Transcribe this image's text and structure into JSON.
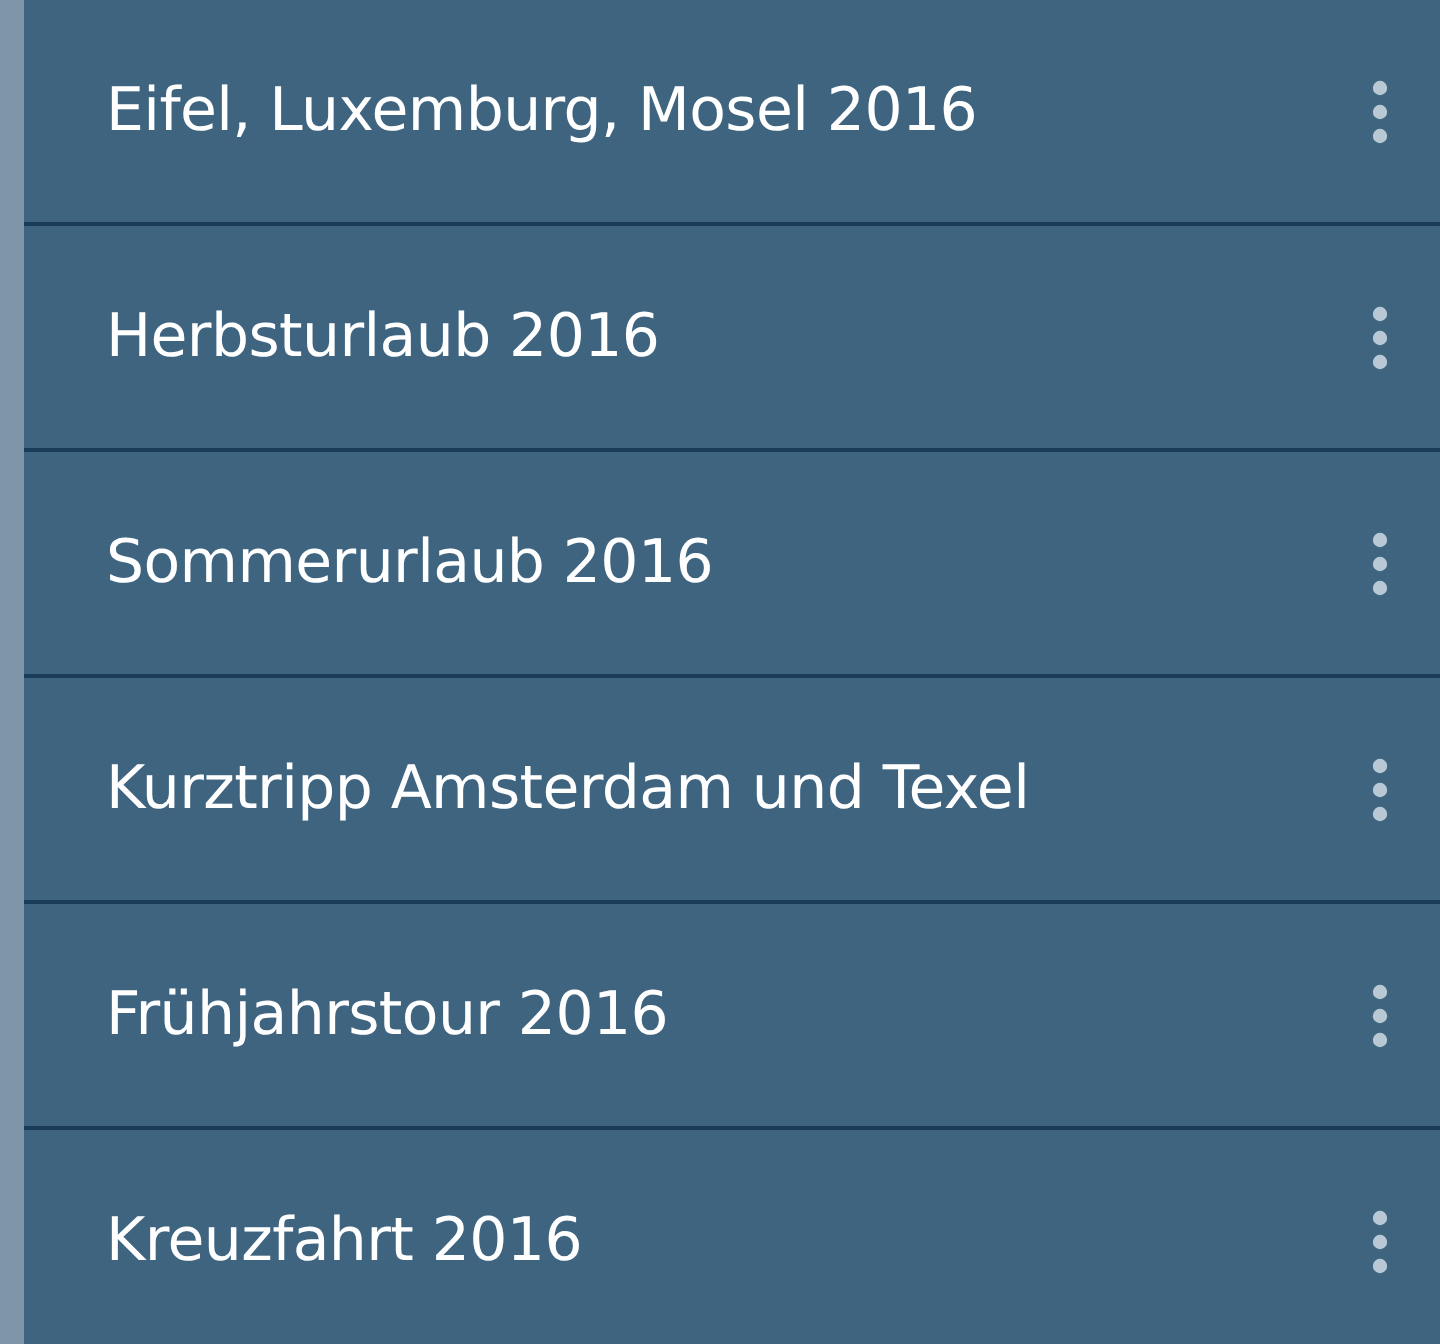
{
  "trips": [
    {
      "title": "Eifel, Luxemburg, Mosel 2016"
    },
    {
      "title": "Herbsturlaub 2016"
    },
    {
      "title": "Sommerurlaub 2016"
    },
    {
      "title": "Kurztripp Amsterdam und Texel"
    },
    {
      "title": "Frühjahrstour 2016"
    },
    {
      "title": "Kreuzfahrt 2016"
    }
  ]
}
